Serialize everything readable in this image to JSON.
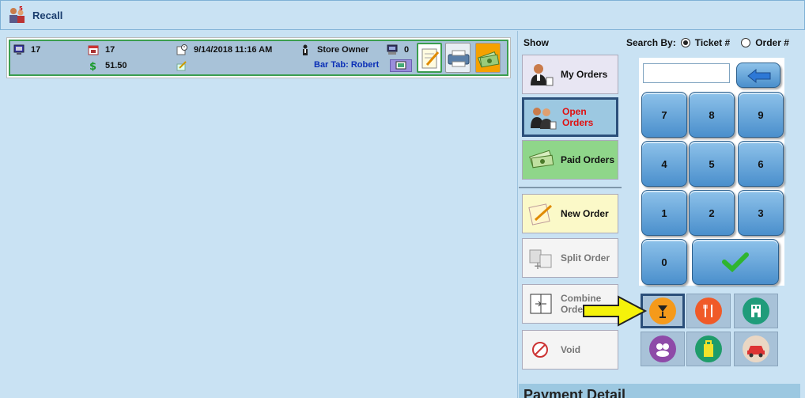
{
  "window": {
    "title": "Recall"
  },
  "order": {
    "table_number": "17",
    "guest_count": "17",
    "total": "51.50",
    "datetime": "9/14/2018 11:16 AM",
    "server": "Store Owner",
    "terminal_count": "0",
    "bar_tab": "Bar Tab: Robert"
  },
  "show": {
    "label": "Show",
    "my_orders": "My Orders",
    "open_orders": "Open Orders",
    "paid_orders": "Paid Orders",
    "new_order": "New Order",
    "split_order": "Split Order",
    "combine_orders": "Combine Orders",
    "void": "Void"
  },
  "search_by": {
    "label": "Search By:",
    "options": [
      "Ticket #",
      "Order #"
    ],
    "selected": "Ticket #"
  },
  "keypad": {
    "keys": [
      "7",
      "8",
      "9",
      "4",
      "5",
      "6",
      "1",
      "2",
      "3",
      "0"
    ]
  },
  "order_types": [
    "bar-icon",
    "dine-in-icon",
    "hotel-icon",
    "group-icon",
    "takeout-icon",
    "delivery-icon"
  ],
  "payment": {
    "title": "Payment Detail"
  },
  "colors": {
    "accent": "#2b4f7a",
    "open_orders_text": "#e01010",
    "link": "#0a2fb6",
    "paid_orders_bg": "#8fd68a",
    "new_order_bg": "#fbf9c8",
    "arrow": "#f5f20a"
  }
}
